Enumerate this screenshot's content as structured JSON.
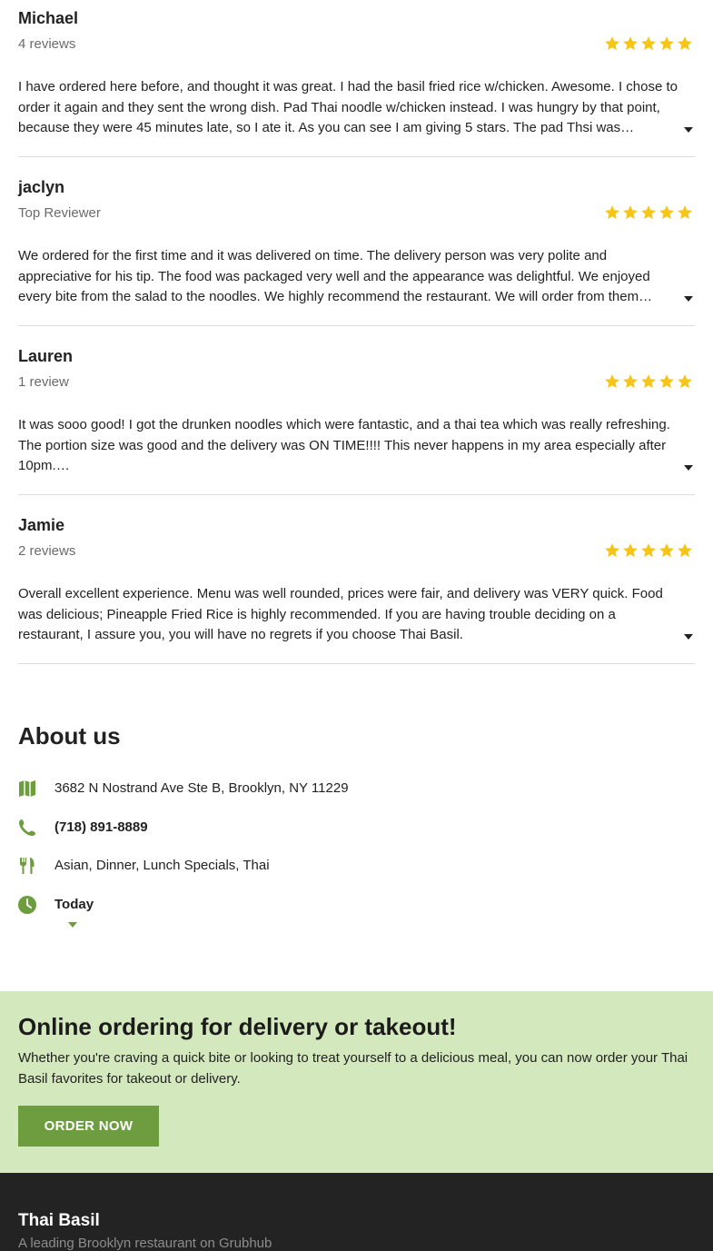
{
  "reviews": [
    {
      "name": "Michael",
      "meta": "4 reviews",
      "rating": 5,
      "text": "I have ordered here before, and thought it was great. I had the basil fried rice w/chicken. Awesome. I chose to order it again and they sent the wrong dish. Pad Thai noodle w/chicken instead. I was hungry by that point, because they were 45 minutes late, so I ate it. As you can see I am giving 5 stars. The pad Thsi was…"
    },
    {
      "name": "jaclyn",
      "meta": "Top Reviewer",
      "rating": 5,
      "text": "We ordered for the first time and it was delivered on time. The delivery person was very polite and appreciative for his tip. The food was packaged very well and the appearance was delightful. We enjoyed every bite from the salad to the noodles. We highly recommend the restaurant. We will order from them…"
    },
    {
      "name": "Lauren",
      "meta": "1 review",
      "rating": 5,
      "text": "It was sooo good! I got the drunken noodles which were fantastic, and a thai tea which was really refreshing. The portion size was good and the delivery was ON TIME!!!! This never happens in my area especially after 10pm.…"
    },
    {
      "name": "Jamie",
      "meta": "2 reviews",
      "rating": 5,
      "text": "Overall excellent experience. Menu was well rounded, prices were fair, and delivery was VERY quick. Food was delicious; Pineapple Fried Rice is highly recommended. If you are having trouble deciding on a restaurant, I assure you, you will have no regrets if you choose Thai Basil."
    }
  ],
  "about": {
    "title": "About us",
    "address": "3682 N Nostrand Ave Ste B, Brooklyn, NY 11229",
    "phone": "(718) 891-8889",
    "cuisines": "Asian, Dinner, Lunch Specials, Thai",
    "hours_label": "Today"
  },
  "promo": {
    "title": "Online ordering for delivery or takeout!",
    "text": "Whether you're craving a quick bite or looking to treat yourself to a delicious meal, you can now order your Thai Basil favorites for takeout or delivery.",
    "button_label": "ORDER NOW"
  },
  "footer": {
    "title": "Thai Basil",
    "subtitle": "A leading Brooklyn restaurant on Grubhub"
  },
  "colors": {
    "star": "#f5c518",
    "accent_green": "#6e9d3f",
    "promo_bg": "#d4e8bd",
    "footer_bg": "#232323"
  },
  "icons": {
    "address": "map-icon",
    "phone": "phone-icon",
    "cuisines": "utensils-icon",
    "hours": "clock-icon",
    "expand": "caret-down-icon",
    "rating": "star-icon"
  }
}
